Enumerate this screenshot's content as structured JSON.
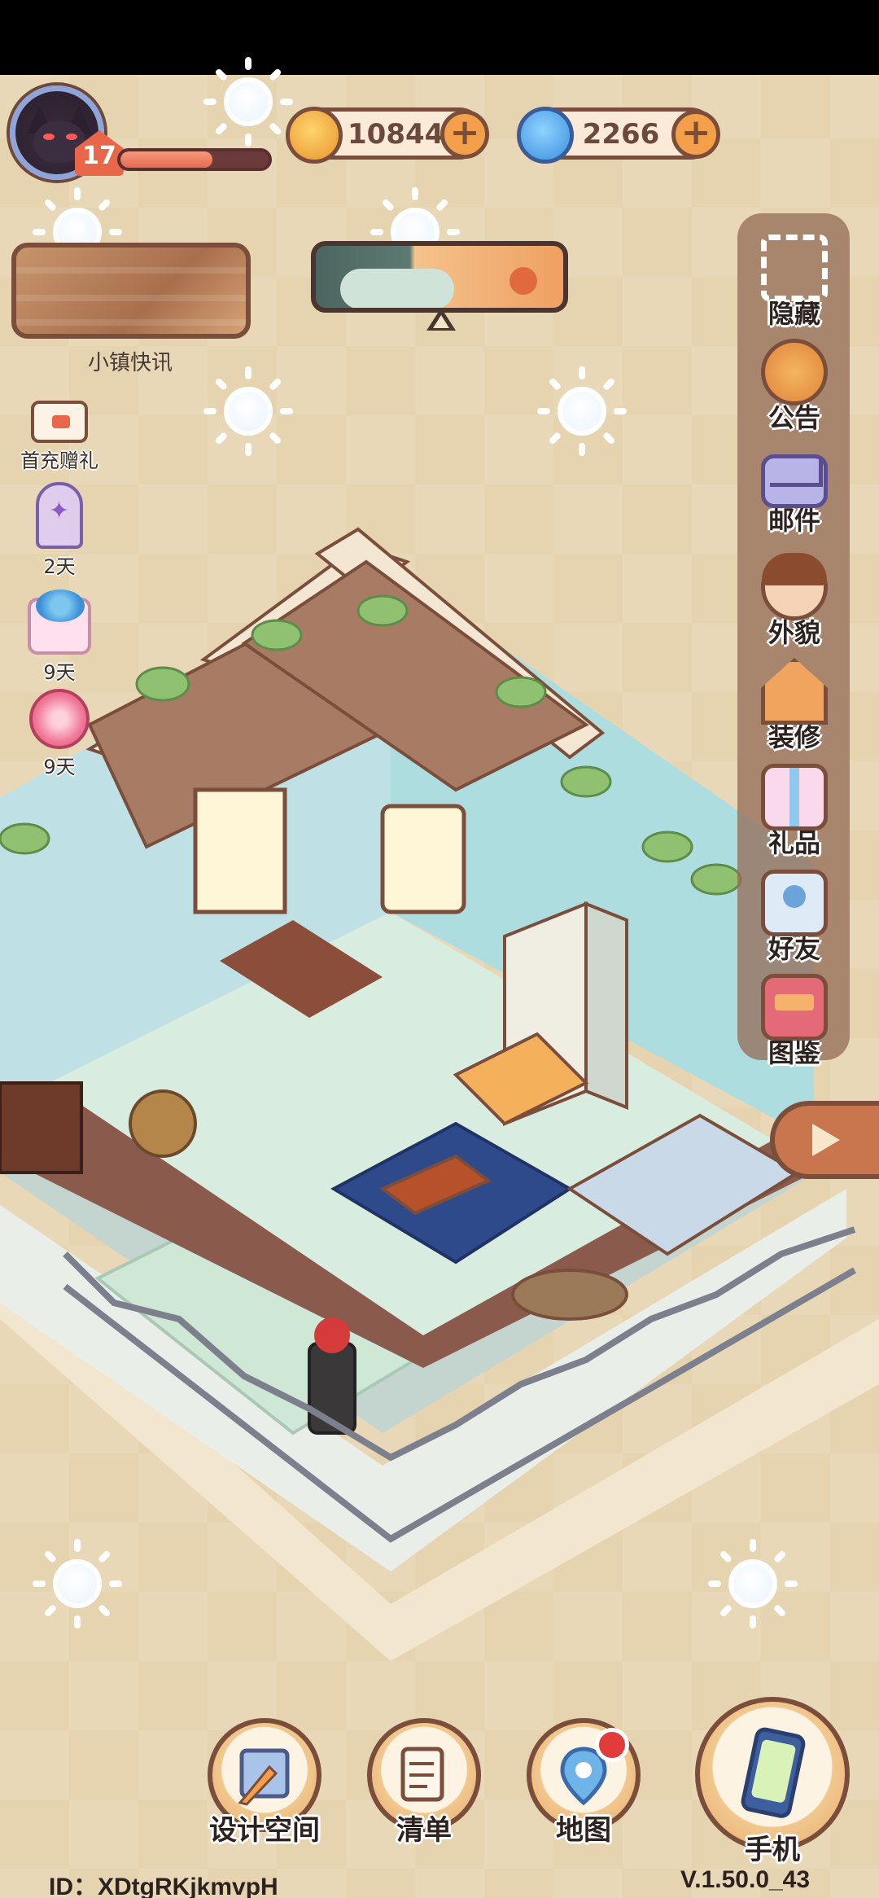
{
  "player": {
    "level": "17",
    "xp_progress": 0.62
  },
  "currencies": {
    "coins": "10844",
    "gems": "2266"
  },
  "town_news": {
    "label": "小镇快讯"
  },
  "left_events": [
    {
      "label": "首充赠礼"
    },
    {
      "label": "2天"
    },
    {
      "label": "9天"
    },
    {
      "label": "9天"
    }
  ],
  "right_menu": [
    {
      "label": "隐藏",
      "icon": "hide-icon"
    },
    {
      "label": "公告",
      "icon": "megaphone-icon"
    },
    {
      "label": "邮件",
      "icon": "mail-icon"
    },
    {
      "label": "外貌",
      "icon": "face-icon"
    },
    {
      "label": "装修",
      "icon": "house-wrench-icon"
    },
    {
      "label": "礼品",
      "icon": "gift-icon"
    },
    {
      "label": "好友",
      "icon": "friend-icon"
    },
    {
      "label": "图鉴",
      "icon": "book-icon"
    }
  ],
  "bottom_nav": [
    {
      "label": "设计空间",
      "icon": "design-icon"
    },
    {
      "label": "清单",
      "icon": "list-icon"
    },
    {
      "label": "地图",
      "icon": "map-pin-icon"
    },
    {
      "label": "手机",
      "icon": "phone-icon"
    }
  ],
  "footer": {
    "id": "ID：XDtgRKjkmvpH",
    "version": "V.1.50.0_43"
  },
  "colors": {
    "background": "#e6d4b0",
    "frame_brown": "#7a4e3b",
    "accent_orange": "#f4a04b",
    "notification_red": "#e23b3b"
  }
}
